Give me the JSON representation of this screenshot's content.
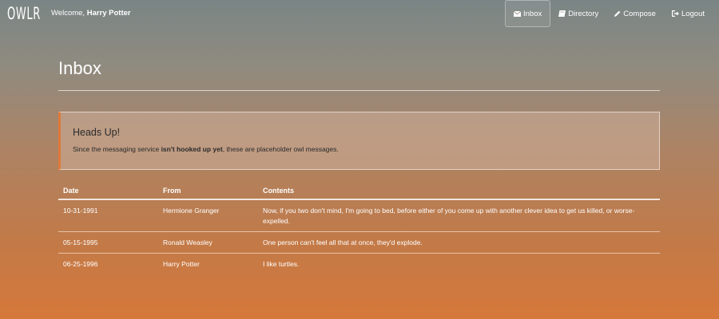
{
  "navbar": {
    "brand": "OWLR",
    "welcome_prefix": "Welcome, ",
    "user_name": "Harry Potter",
    "links": [
      {
        "label": "Inbox",
        "icon": "envelope-icon",
        "active": true
      },
      {
        "label": "Directory",
        "icon": "book-icon",
        "active": false
      },
      {
        "label": "Compose",
        "icon": "pencil-icon",
        "active": false
      },
      {
        "label": "Logout",
        "icon": "logout-icon",
        "active": false
      }
    ]
  },
  "page": {
    "title": "Inbox"
  },
  "alert": {
    "heading": "Heads Up!",
    "body_prefix": "Since the messaging service ",
    "body_bold": "isn't hooked up yet",
    "body_suffix": ", these are placeholder owl messages."
  },
  "table": {
    "headers": [
      "Date",
      "From",
      "Contents"
    ],
    "rows": [
      {
        "date": "10-31-1991",
        "from": "Hermione Granger",
        "contents": "Now, if you two don't mind, I'm going to bed, before either of you come up with another clever idea to get us killed, or worse- expelled."
      },
      {
        "date": "05-15-1995",
        "from": "Ronald Weasley",
        "contents": "One person can't feel all that at once, they'd explode."
      },
      {
        "date": "06-25-1996",
        "from": "Harry Potter",
        "contents": "I like turtles."
      }
    ]
  },
  "colors": {
    "accent": "#e0793a",
    "alert_text": "#2a2a2a"
  }
}
